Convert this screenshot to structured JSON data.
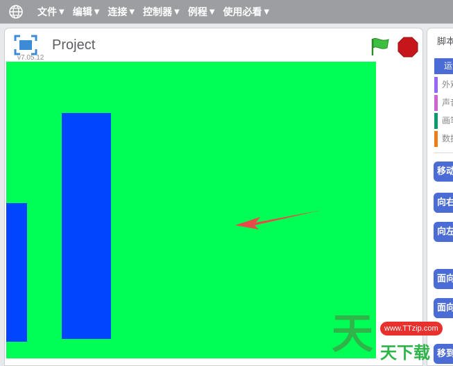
{
  "menu": {
    "items": [
      {
        "label": "文件"
      },
      {
        "label": "编辑"
      },
      {
        "label": "连接"
      },
      {
        "label": "控制器"
      },
      {
        "label": "例程"
      },
      {
        "label": "使用必看"
      }
    ],
    "caret": "▼"
  },
  "stage_panel": {
    "title": "Project",
    "version": "v7.05.12",
    "stage_color": "#00ff55",
    "sprite_color": "#0044ff",
    "annotation_arrow_color": "#e84a4a"
  },
  "script_panel": {
    "tab_label": "脚本",
    "categories": [
      {
        "label": "运动",
        "color": "#4a6cd4"
      },
      {
        "label": "外观",
        "color": "#9966ff"
      },
      {
        "label": "声音",
        "color": "#cf63cf"
      },
      {
        "label": "画笔",
        "color": "#0e9a6c"
      },
      {
        "label": "数据",
        "color": "#ee7d16"
      }
    ],
    "blocks": [
      {
        "label": "移动"
      },
      {
        "label": "向右"
      },
      {
        "label": "向左"
      },
      {
        "label": "面向"
      },
      {
        "label": "面向"
      },
      {
        "label": "移到"
      }
    ]
  },
  "watermark": {
    "glyph": "天",
    "url": "www.TTzip.com",
    "text": "天下载"
  }
}
